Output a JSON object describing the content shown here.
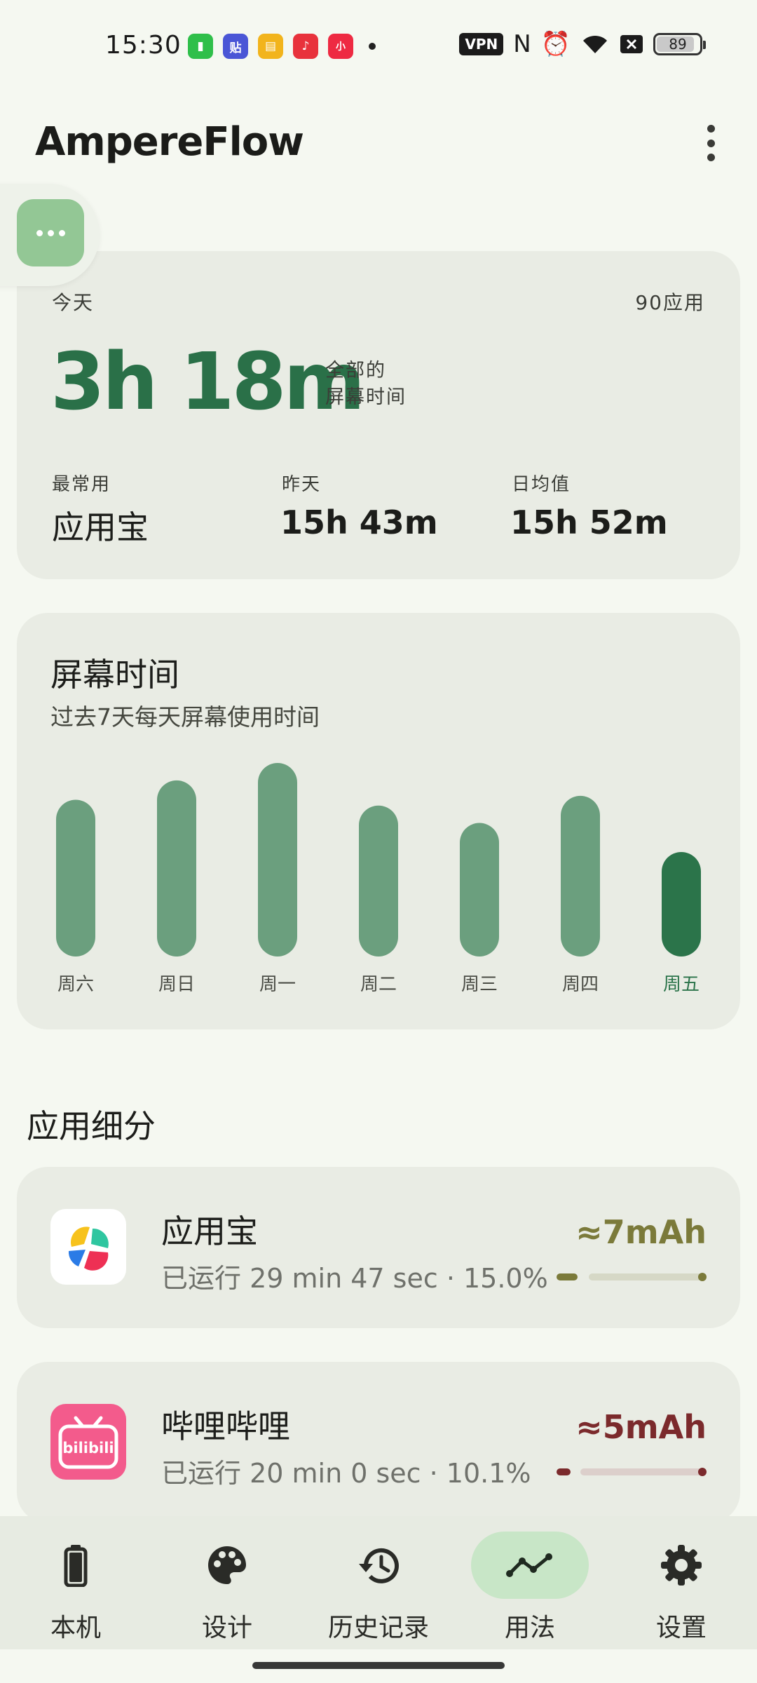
{
  "status_bar": {
    "time": "15:30",
    "notifications": [
      {
        "icon": "battery-app-icon",
        "color": "#2fbf4a",
        "glyph": "▮"
      },
      {
        "icon": "tieba-icon",
        "color": "#4a56d6",
        "glyph": "贴"
      },
      {
        "icon": "reader-icon",
        "color": "#f2b41c",
        "glyph": "▤"
      },
      {
        "icon": "music-icon",
        "color": "#e8323c",
        "glyph": "♪"
      },
      {
        "icon": "xiaohongshu-icon",
        "color": "#ee2a42",
        "glyph": "小"
      }
    ],
    "vpn": "VPN",
    "battery_level": "89",
    "battery_fraction": 0.89
  },
  "app_bar": {
    "title": "AmpereFlow"
  },
  "summary": {
    "today_label": "今天",
    "apps_count": "90应用",
    "total_time": "3h 18m",
    "total_caption_line1": "全部的",
    "total_caption_line2": "屏幕时间",
    "most_used_label": "最常用",
    "most_used_value": "应用宝",
    "yesterday_label": "昨天",
    "yesterday_value": "15h 43m",
    "daily_avg_label": "日均值",
    "daily_avg_value": "15h 52m"
  },
  "chart": {
    "title": "屏幕时间",
    "subtitle": "过去7天每天屏幕使用时间"
  },
  "chart_data": {
    "type": "bar",
    "title": "屏幕时间",
    "subtitle": "过去7天每天屏幕使用时间",
    "categories": [
      "周六",
      "周日",
      "周一",
      "周二",
      "周三",
      "周四",
      "周五"
    ],
    "values": [
      0.81,
      0.91,
      1.0,
      0.78,
      0.69,
      0.83,
      0.54
    ],
    "highlight_index": 6,
    "bar_color": "#6b9f7e",
    "highlight_color": "#2b744a",
    "grid": false
  },
  "breakdown": {
    "title": "应用细分",
    "apps": [
      {
        "name": "应用宝",
        "runtime": "已运行 29 min 47 sec · 15.0%",
        "mah": "≈7mAh",
        "accent": "#7b7a3a",
        "track": "#d6d8c6",
        "share": 0.15
      },
      {
        "name": "哔哩哔哩",
        "runtime": "已运行 20 min 0 sec · 10.1%",
        "mah": "≈5mAh",
        "accent": "#7b2a2c",
        "track": "#dccfcb",
        "share": 0.101
      }
    ]
  },
  "bottom_nav": {
    "items": [
      {
        "label": "本机",
        "icon": "battery-icon"
      },
      {
        "label": "设计",
        "icon": "palette-icon"
      },
      {
        "label": "历史记录",
        "icon": "history-icon"
      },
      {
        "label": "用法",
        "icon": "usage-trend-icon"
      },
      {
        "label": "设置",
        "icon": "gear-icon"
      }
    ],
    "active_index": 3
  }
}
